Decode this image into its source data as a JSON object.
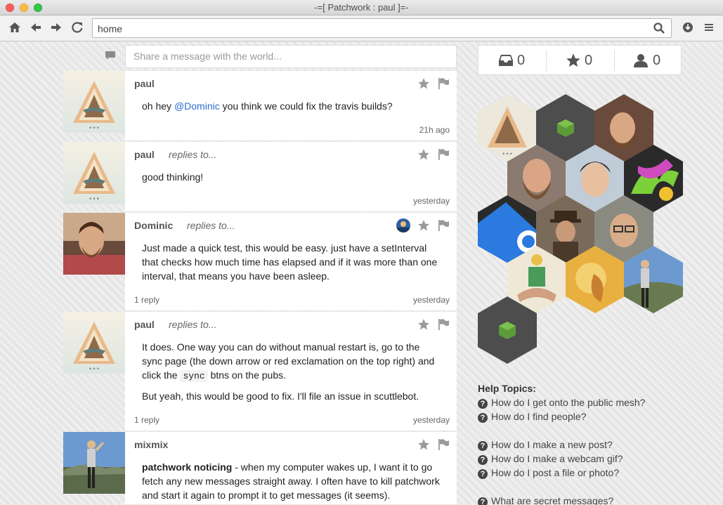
{
  "window": {
    "title": "-=[ Patchwork : paul ]=-"
  },
  "toolbar": {
    "address_value": "home",
    "icons": [
      "home-icon",
      "back-icon",
      "forward-icon",
      "reload-icon",
      "search-icon",
      "download-icon",
      "menu-icon"
    ]
  },
  "composer": {
    "placeholder": "Share a message with the world..."
  },
  "posts": [
    {
      "author": "paul",
      "replies_label": "",
      "text": [
        "oh hey ",
        "@Dominic",
        " you think we could fix the travis builds?"
      ],
      "time": "21h ago",
      "reply_count": ""
    },
    {
      "author": "paul",
      "replies_label": "replies to...",
      "text": [
        "good thinking!"
      ],
      "time": "yesterday",
      "reply_count": ""
    },
    {
      "author": "Dominic",
      "replies_label": "replies to...",
      "text": [
        "Just made a quick test, this would be easy. just have a setInterval that checks how much time has elapsed and if it was more than one interval, that means you have been asleep."
      ],
      "time": "yesterday",
      "reply_count": "1 reply"
    },
    {
      "author": "paul",
      "replies_label": "replies to...",
      "text": [
        "It does. One way you can do without manual restart is, go to the sync page (the down arrow or red exclamation on the top right) and click the ",
        "sync",
        " btns on the pubs.",
        "But yeah, this would be good to fix. I'll file an issue in scuttlebot."
      ],
      "time": "yesterday",
      "reply_count": "1 reply"
    },
    {
      "author": "mixmix",
      "replies_label": "",
      "text": [
        "patchwork noticing",
        " - when my computer wakes up, I want it to go fetch any new messages straight away. I often have to kill patchwork and start it again to prompt it to get messages (it seems)."
      ],
      "time": "",
      "reply_count": ""
    }
  ],
  "stats": {
    "inbox": "0",
    "stars": "0",
    "follows": "0"
  },
  "help": {
    "title": "Help Topics:",
    "items": [
      "How do I get onto the public mesh?",
      "How do I find people?",
      "How do I make a new post?",
      "How do I make a webcam gif?",
      "How do I post a file or photo?",
      "What are secret messages?"
    ]
  },
  "colors": {
    "accent_link": "#2a6fd0",
    "icon_gray": "#9a9a9a"
  }
}
